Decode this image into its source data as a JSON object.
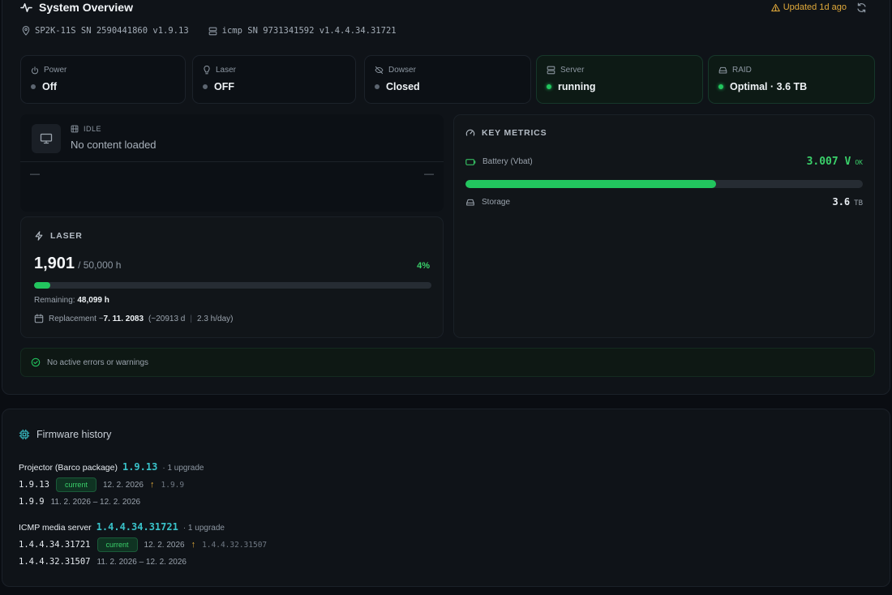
{
  "header": {
    "title": "System Overview",
    "updated": "Updated 1d ago"
  },
  "device": {
    "projector": "SP2K-11S SN 2590441860 v1.9.13",
    "server": "icmp SN 9731341592 v1.4.4.34.31721"
  },
  "status_tiles": [
    {
      "label": "Power",
      "value": "Off",
      "state": "off"
    },
    {
      "label": "Laser",
      "value": "OFF",
      "state": "off"
    },
    {
      "label": "Dowser",
      "value": "Closed",
      "state": "off"
    },
    {
      "label": "Server",
      "value": "running",
      "state": "ok"
    },
    {
      "label": "RAID",
      "value": "Optimal · 3.6 TB",
      "state": "ok"
    }
  ],
  "content": {
    "state": "IDLE",
    "message": "No content loaded",
    "left_placeholder": "—",
    "right_placeholder": "—"
  },
  "laser": {
    "title": "LASER",
    "hours": "1,901",
    "of_hours": "/ 50,000 h",
    "percent_label": "4%",
    "percent": 0.04,
    "remaining_label": "Remaining:",
    "remaining_value": "48,099 h",
    "replacement_label": "Replacement ~",
    "replacement_date": "7. 11. 2083",
    "replacement_days": "(~20913 d",
    "replacement_rate": "2.3 h/day)"
  },
  "metrics": {
    "title": "KEY METRICS",
    "battery_label": "Battery (Vbat)",
    "battery_value": "3.007 V",
    "battery_status": "OK",
    "battery_fill": 0.63,
    "storage_label": "Storage",
    "storage_value": "3.6",
    "storage_unit": "TB"
  },
  "errors": {
    "message": "No active errors or warnings"
  },
  "firmware": {
    "title": "Firmware history",
    "groups": [
      {
        "name": "Projector (Barco package)",
        "current_version": "1.9.13",
        "upgrades": "· 1 upgrade",
        "rows": [
          {
            "version": "1.9.13",
            "badge": "current",
            "date": "12. 2. 2026",
            "prev": "1.9.9"
          },
          {
            "version": "1.9.9",
            "range": "11. 2. 2026 – 12. 2. 2026"
          }
        ]
      },
      {
        "name": "ICMP media server",
        "current_version": "1.4.4.34.31721",
        "upgrades": "· 1 upgrade",
        "rows": [
          {
            "version": "1.4.4.34.31721",
            "badge": "current",
            "date": "12. 2. 2026",
            "prev": "1.4.4.32.31507"
          },
          {
            "version": "1.4.4.32.31507",
            "range": "11. 2. 2026 – 12. 2. 2026"
          }
        ]
      }
    ]
  },
  "colors": {
    "accent_green": "#22c55e",
    "warning": "#e0a93a",
    "accent_cyan": "#39c2c9"
  }
}
